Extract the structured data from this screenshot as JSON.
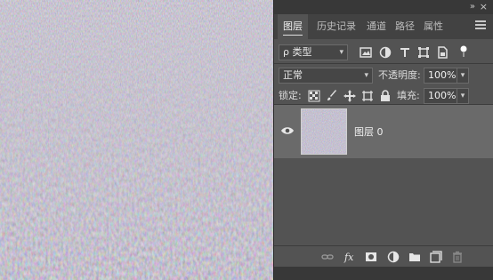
{
  "panel": {
    "tabs": [
      {
        "label": "图层",
        "active": true
      },
      {
        "label": "历史记录",
        "active": false
      },
      {
        "label": "通道",
        "active": false
      },
      {
        "label": "路径",
        "active": false
      },
      {
        "label": "属性",
        "active": false
      }
    ],
    "filter": {
      "label": "ρ 类型"
    },
    "blend_mode": "正常",
    "opacity": {
      "label": "不透明度:",
      "value": "100%"
    },
    "lock": {
      "label": "锁定:"
    },
    "fill": {
      "label": "填充:",
      "value": "100%"
    },
    "layers": [
      {
        "name": "图层 0",
        "visible": true,
        "selected": true
      }
    ],
    "footer_icons": [
      "link-icon",
      "fx-icon",
      "mask-icon",
      "adjustment-icon",
      "folder-icon",
      "new-layer-icon",
      "trash-icon"
    ]
  },
  "colors": {
    "panel_bg": "#535353",
    "tab_bar_bg": "#424242",
    "selected_layer_bg": "#6a6a6a",
    "canvas_texture": "#8c8ca0"
  }
}
